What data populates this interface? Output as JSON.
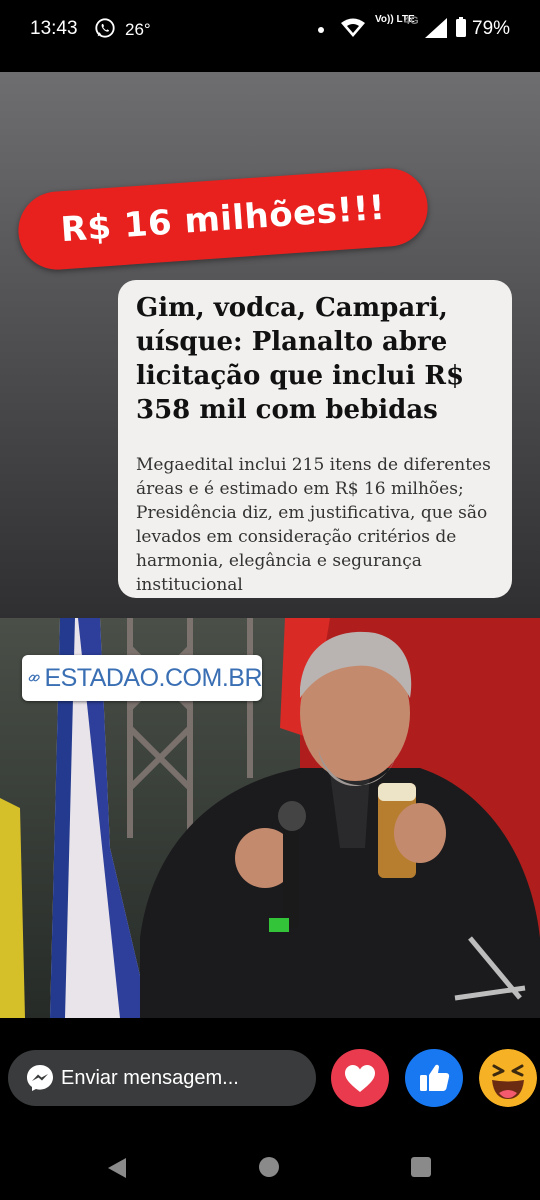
{
  "status_bar": {
    "time": "13:43",
    "temperature": "26°",
    "network_volte": "Vo)) LTE",
    "network_type": "4G",
    "battery": "79%",
    "icons": [
      "whatsapp-icon",
      "wifi-icon",
      "signal-icon",
      "battery-icon"
    ]
  },
  "post": {
    "banner": "R$ 16 milhões!!!",
    "headline": "Gim, vodca, Campari, uísque: Planalto abre licitação que inclui R$ 358 mil com bebidas",
    "subheadline": "Megaedital inclui 215 itens de diferentes áreas e é estimado em R$ 16 milhões; Presidência diz, em justificativa, que são levados em consideração critérios de harmonia, elegância e segurança institucional",
    "source": "ESTADAO.COM.BR"
  },
  "comment_bar": {
    "message_placeholder": "Enviar mensagem...",
    "reactions": [
      "love-icon",
      "like-icon",
      "haha-icon"
    ]
  },
  "nav": {
    "buttons": [
      "back",
      "home",
      "recents"
    ]
  },
  "colors": {
    "banner": "#e8211f",
    "love": "#e93a4e",
    "like": "#1878f2",
    "haha": "#f7b125",
    "source_link": "#3a6fb4"
  }
}
